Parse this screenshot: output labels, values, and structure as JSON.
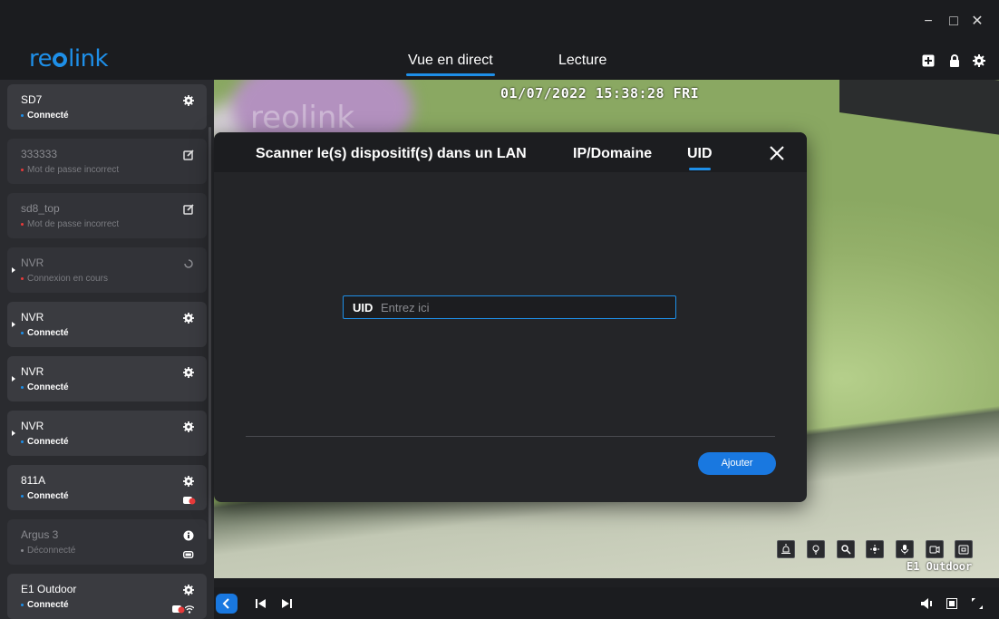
{
  "window": {
    "minimize": "−",
    "maximize": "□",
    "close": "✕"
  },
  "header": {
    "logo": {
      "before": "re",
      "after": "link"
    },
    "tabs": [
      {
        "label": "Vue en direct",
        "active": true
      },
      {
        "label": "Lecture",
        "active": false
      }
    ],
    "icons": [
      "add-device-icon",
      "lock-icon",
      "settings-gear-icon"
    ]
  },
  "sidebar": {
    "devices": [
      {
        "name": "SD7",
        "status": "Connecté",
        "status_color": "#1e8fe8",
        "action_icon": "gear-icon",
        "dim": false
      },
      {
        "name": "333333",
        "status": "Mot de passe incorrect",
        "status_color": "#e83a3a",
        "action_icon": "edit-icon",
        "dim": true
      },
      {
        "name": "sd8_top",
        "status": "Mot de passe incorrect",
        "status_color": "#e83a3a",
        "action_icon": "edit-icon",
        "dim": true
      },
      {
        "name": "NVR",
        "status": "Connexion en cours",
        "status_color": "#e83a3a",
        "action_icon": "loading-icon",
        "dim": true,
        "expandable": true
      },
      {
        "name": "NVR",
        "status": "Connecté",
        "status_color": "#1e8fe8",
        "action_icon": "gear-icon",
        "dim": false,
        "expandable": true
      },
      {
        "name": "NVR",
        "status": "Connecté",
        "status_color": "#1e8fe8",
        "action_icon": "gear-icon",
        "dim": false,
        "expandable": true
      },
      {
        "name": "NVR",
        "status": "Connecté",
        "status_color": "#1e8fe8",
        "action_icon": "gear-icon",
        "dim": false,
        "expandable": true
      },
      {
        "name": "811A",
        "status": "Connecté",
        "status_color": "#1e8fe8",
        "action_icon": "gear-icon",
        "dim": false,
        "sub_icons": [
          "camera-record-icon"
        ]
      },
      {
        "name": "Argus 3",
        "status": "Déconnecté",
        "status_color": "#8a8b90",
        "action_icon": "info-icon",
        "dim": true,
        "sub_icons": [
          "battery-icon"
        ]
      },
      {
        "name": "E1 Outdoor",
        "status": "Connecté",
        "status_color": "#1e8fe8",
        "action_icon": "gear-icon",
        "dim": false,
        "sub_icons": [
          "camera-record-icon",
          "wifi-icon"
        ]
      }
    ]
  },
  "video": {
    "timestamp": "01/07/2022 15:38:28 FRI",
    "watermark": "reolink",
    "camera_label": "E1 Outdoor",
    "tools": [
      "siren-icon",
      "floodlight-icon",
      "zoom-icon",
      "ptz-icon",
      "microphone-icon",
      "record-icon",
      "snapshot-icon"
    ]
  },
  "dialog": {
    "tabs": [
      {
        "label": "Scanner le(s) dispositif(s) dans un LAN",
        "active": false
      },
      {
        "label": "IP/Domaine",
        "active": false
      },
      {
        "label": "UID",
        "active": true
      }
    ],
    "uid_label": "UID",
    "uid_placeholder": "Entrez ici",
    "uid_value": "",
    "add_button": "Ajouter"
  },
  "colors": {
    "accent": "#1e8fe8",
    "error": "#e83a3a",
    "panel": "#242528"
  }
}
